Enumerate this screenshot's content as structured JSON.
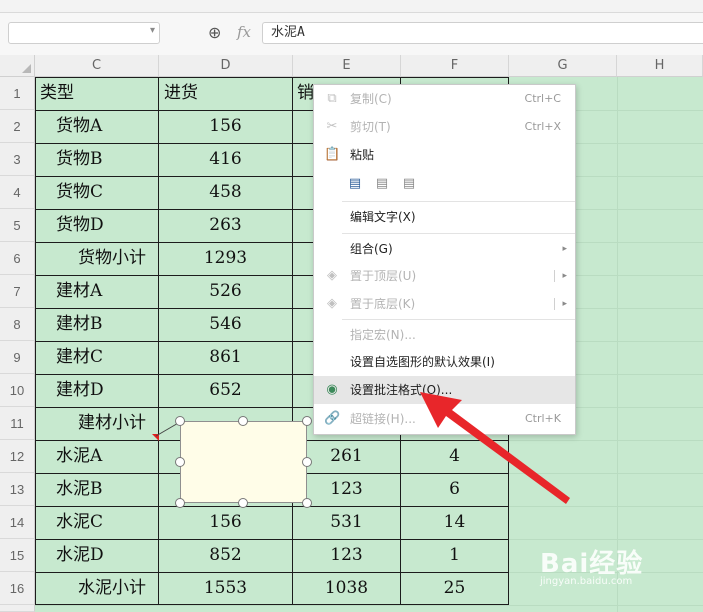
{
  "formula_bar": {
    "name_box_value": "",
    "fx_label": "fx",
    "formula_value": "水泥A"
  },
  "columns": [
    "C",
    "D",
    "E",
    "F",
    "G",
    "H"
  ],
  "rows": [
    "1",
    "2",
    "3",
    "4",
    "5",
    "6",
    "7",
    "8",
    "9",
    "10",
    "11",
    "12",
    "13",
    "14",
    "15",
    "16"
  ],
  "table": {
    "header": [
      "类型",
      "进货",
      "销"
    ],
    "type_col": [
      "货物A",
      "货物B",
      "货物C",
      "货物D",
      "货物小计",
      "建材A",
      "建材B",
      "建材C",
      "建材D",
      "建材小计",
      "水泥A",
      "水泥B",
      "水泥C",
      "水泥D",
      "水泥小计"
    ],
    "d_col": [
      "156",
      "416",
      "458",
      "263",
      "1293",
      "526",
      "546",
      "861",
      "652",
      "",
      "",
      "",
      "156",
      "852",
      "1553"
    ],
    "e_col": [
      "",
      "",
      "",
      "",
      "",
      "",
      "",
      "",
      "",
      "",
      "261",
      "123",
      "531",
      "123",
      "1038"
    ],
    "f_col": [
      "",
      "",
      "",
      "",
      "",
      "",
      "",
      "",
      "",
      "",
      "4",
      "6",
      "14",
      "1",
      "25"
    ]
  },
  "context_menu": {
    "copy": {
      "label": "复制(C)",
      "shortcut": "Ctrl+C"
    },
    "cut": {
      "label": "剪切(T)",
      "shortcut": "Ctrl+X"
    },
    "paste": {
      "label": "粘贴"
    },
    "edit_text": {
      "label": "编辑文字(X)"
    },
    "group": {
      "label": "组合(G)"
    },
    "bring_front": {
      "label": "置于顶层(U)"
    },
    "send_back": {
      "label": "置于底层(K)"
    },
    "assign_macro": {
      "label": "指定宏(N)..."
    },
    "set_default_effect": {
      "label": "设置自选图形的默认效果(I)"
    },
    "format_comment": {
      "label": "设置批注格式(O)..."
    },
    "hyperlink": {
      "label": "超链接(H)...",
      "shortcut": "Ctrl+K"
    }
  },
  "watermark": {
    "brand": "Bai经验",
    "site": "jingyan.baidu.com"
  },
  "colors": {
    "sheet_green": "#c7e9cf",
    "arrow_red": "#e8262a",
    "comment_fill": "#fffde8"
  }
}
